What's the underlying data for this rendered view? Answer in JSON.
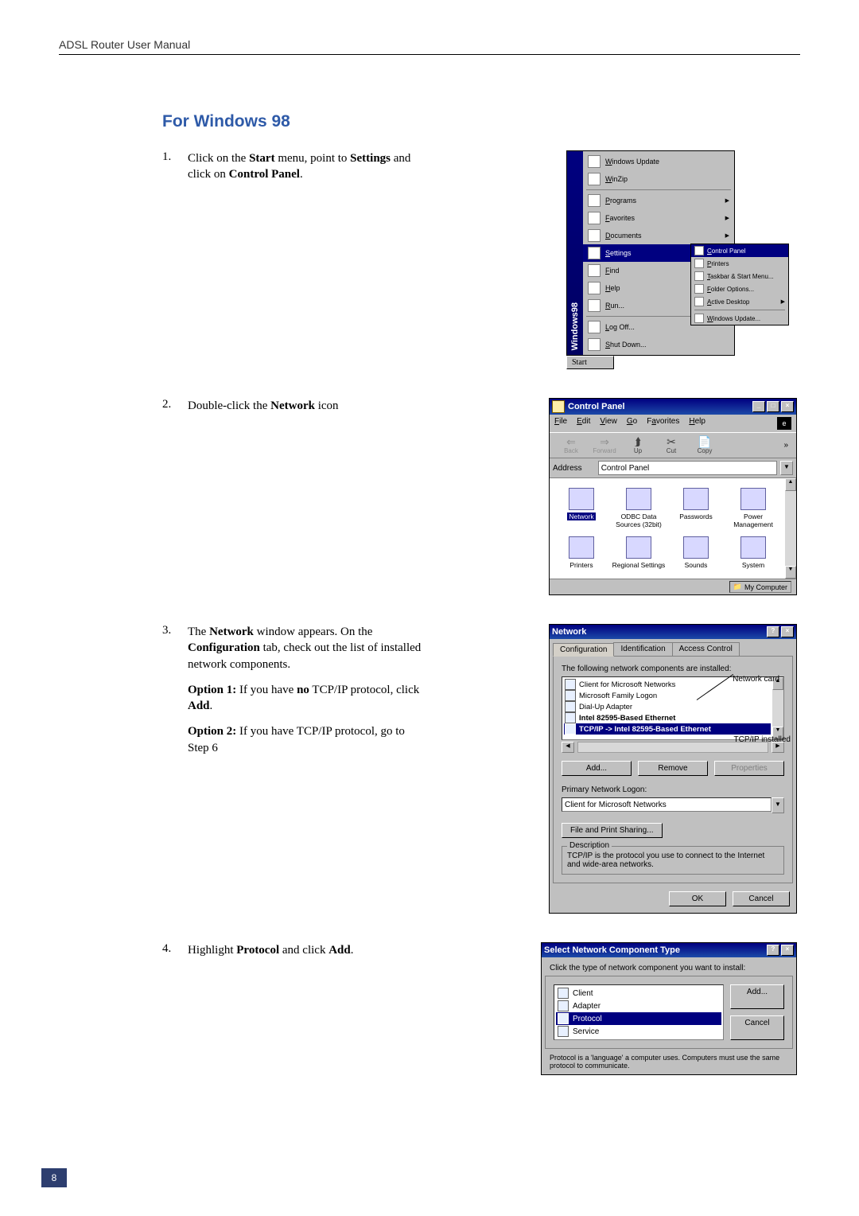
{
  "header": {
    "running_head": "ADSL Router User Manual"
  },
  "section_title": "For Windows 98",
  "page_number": "8",
  "steps": {
    "1": {
      "num": "1.",
      "body": "Click on the <b>Start</b> menu, point to <b>Settings</b> and click on <b>Control Panel</b>."
    },
    "2": {
      "num": "2.",
      "body": "Double-click the <b>Network</b> icon"
    },
    "3": {
      "num": "3.",
      "p1": "The <b>Network</b> window appears. On the <b>Configuration</b> tab, check out the list of installed network components.",
      "p2": "<b>Option 1:</b> If you have <b>no</b> TCP/IP protocol, click <b>Add</b>.",
      "p3": "<b>Option 2:</b> If you have TCP/IP protocol, go to Step 6"
    },
    "4": {
      "num": "4.",
      "body": "Highlight <b>Protocol</b> and click <b>Add</b>."
    }
  },
  "start_menu": {
    "band": "Windows98",
    "items": [
      {
        "label": "Windows Update",
        "sub": false
      },
      {
        "label": "WinZip",
        "sub": false
      },
      {
        "label": "Programs",
        "sub": true
      },
      {
        "label": "Favorites",
        "sub": true
      },
      {
        "label": "Documents",
        "sub": true
      },
      {
        "label": "Settings",
        "sub": true,
        "selected": true
      },
      {
        "label": "Find",
        "sub": true
      },
      {
        "label": "Help",
        "sub": false
      },
      {
        "label": "Run...",
        "sub": false
      },
      {
        "label": "Log Off...",
        "sub": false
      },
      {
        "label": "Shut Down...",
        "sub": false
      }
    ],
    "separators_after": [
      1,
      8
    ],
    "submenu": [
      {
        "label": "Control Panel",
        "selected": true
      },
      {
        "label": "Printers"
      },
      {
        "label": "Taskbar & Start Menu..."
      },
      {
        "label": "Folder Options..."
      },
      {
        "label": "Active Desktop",
        "sub": true
      },
      {
        "label": "Windows Update..."
      }
    ],
    "submenu_sep_after": [
      4
    ],
    "start_button": "Start"
  },
  "control_panel": {
    "title": "Control Panel",
    "menus": {
      "file": "File",
      "edit": "Edit",
      "view": "View",
      "go": "Go",
      "fav": "Favorites",
      "help": "Help"
    },
    "toolbar": {
      "back": "Back",
      "forward": "Forward",
      "up": "Up",
      "cut": "Cut",
      "copy": "Copy",
      "chevrons": "»"
    },
    "address_label": "Address",
    "address_value": "Control Panel",
    "icons": [
      {
        "label": "Network",
        "selected": true
      },
      {
        "label": "ODBC Data Sources (32bit)"
      },
      {
        "label": "Passwords"
      },
      {
        "label": "Power Management"
      },
      {
        "label": "Printers"
      },
      {
        "label": "Regional Settings"
      },
      {
        "label": "Sounds"
      },
      {
        "label": "System"
      }
    ],
    "status": "My Computer"
  },
  "network_dlg": {
    "title": "Network",
    "tabs": {
      "config": "Configuration",
      "ident": "Identification",
      "access": "Access Control"
    },
    "list_label": "The following network components are installed:",
    "components": [
      "Client for Microsoft Networks",
      "Microsoft Family Logon",
      "Dial-Up Adapter",
      "Intel 82595-Based Ethernet",
      "TCP/IP -> Intel 82595-Based Ethernet"
    ],
    "selected_index": 4,
    "btn_add": "Add...",
    "btn_remove": "Remove",
    "btn_props": "Properties",
    "logon_label": "Primary Network Logon:",
    "logon_value": "Client for Microsoft Networks",
    "btn_share": "File and Print Sharing...",
    "desc_title": "Description",
    "desc_text": "TCP/IP is the protocol you use to connect to the Internet and wide-area networks.",
    "ok": "OK",
    "cancel": "Cancel",
    "callout_card": "Network card",
    "callout_tcp": "TCP/IP installed"
  },
  "select_comp": {
    "title": "Select Network Component Type",
    "prompt": "Click the type of network component you want to install:",
    "list": [
      "Client",
      "Adapter",
      "Protocol",
      "Service"
    ],
    "selected_index": 2,
    "btn_add": "Add...",
    "btn_cancel": "Cancel",
    "explain": "Protocol is a 'language' a computer uses. Computers must use the same protocol to communicate."
  }
}
